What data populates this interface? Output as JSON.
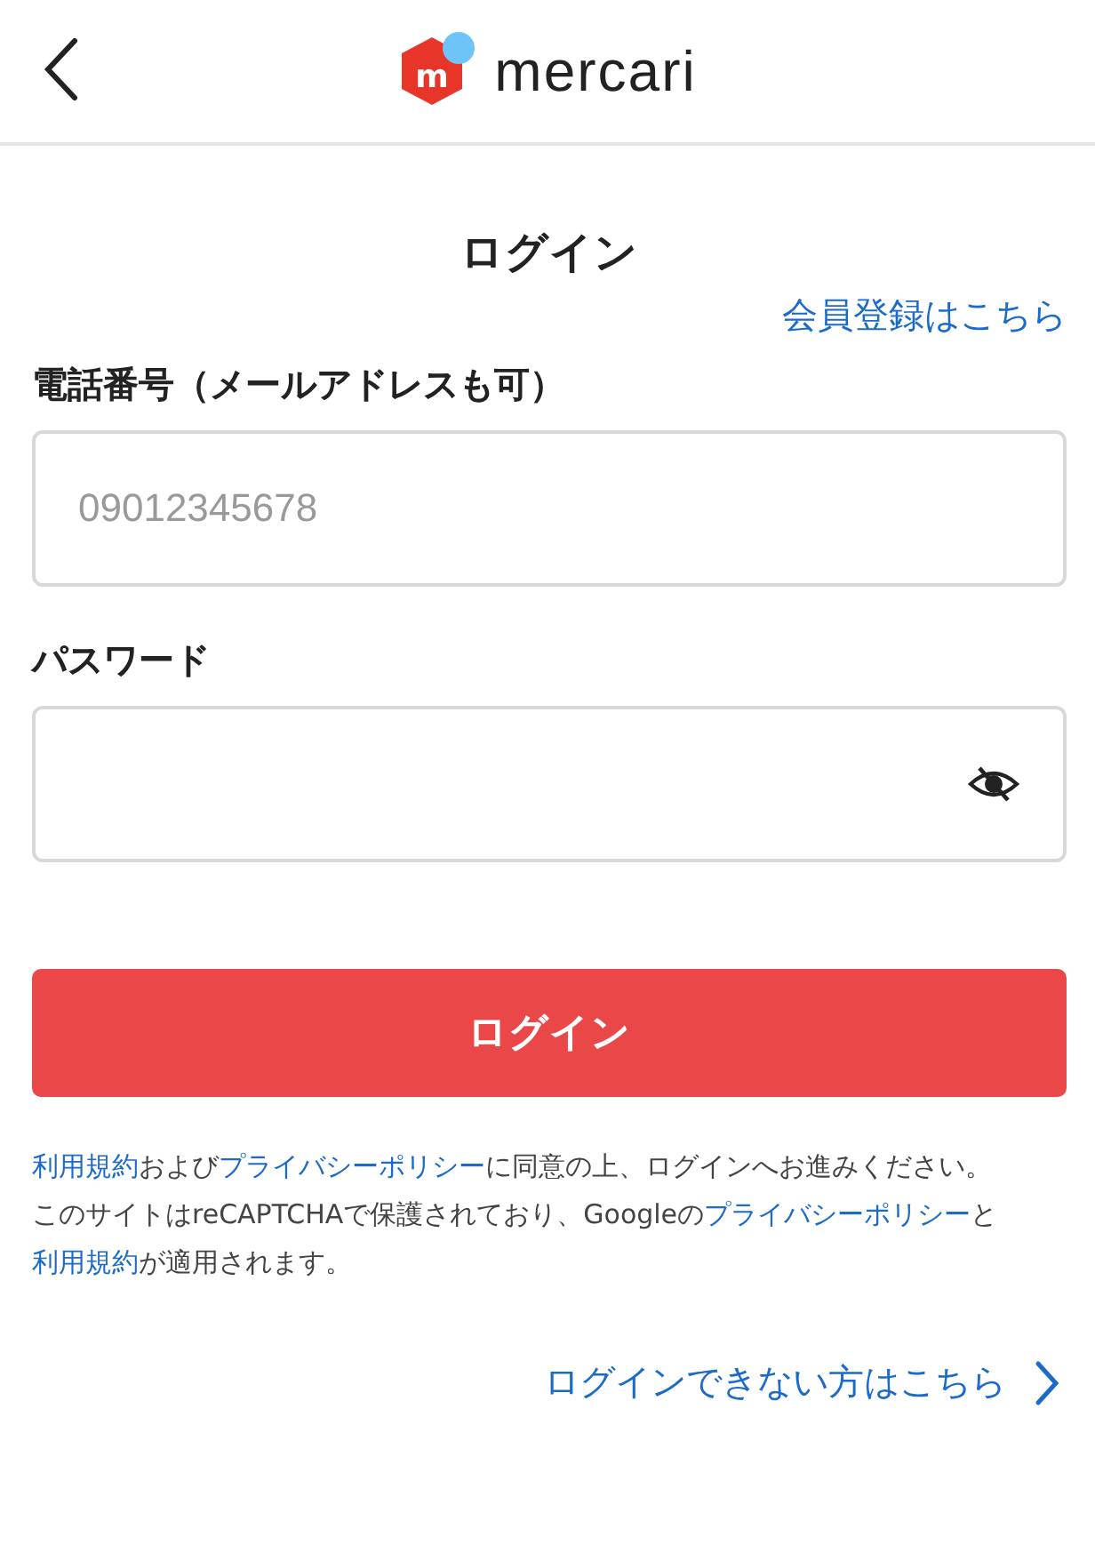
{
  "header": {
    "logo_mark": "m",
    "logo_text": "mercari"
  },
  "title": "ログイン",
  "signup_link": "会員登録はこちら",
  "fields": [
    {
      "kind": "text",
      "label": "電話番号（メールアドレスも可）",
      "placeholder": "09012345678"
    },
    {
      "kind": "password",
      "label": "パスワード",
      "password_hidden": true
    }
  ],
  "submit": "ログイン",
  "notes": [
    [
      {
        "text": "利用規約",
        "link": true
      },
      {
        "text": "および",
        "link": false
      },
      {
        "text": "プライバシーポリシー",
        "link": true
      },
      {
        "text": "に同意の上、ログインへお進みください。",
        "link": false
      }
    ],
    [
      {
        "text": "このサイトはreCAPTCHAで保護されており、Googleの",
        "link": false
      },
      {
        "text": "プライバシーポリシー",
        "link": true
      },
      {
        "text": "と",
        "link": false
      },
      {
        "text": "利用規約",
        "link": true
      },
      {
        "text": "が適用されます。",
        "link": false
      }
    ]
  ],
  "help_link": "ログインできない方はこちら"
}
